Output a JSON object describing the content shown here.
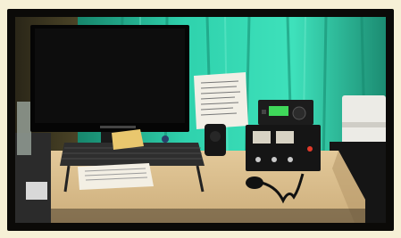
{
  "photo": {
    "scene": "ham-radio-station-desk",
    "monitor_brand": "",
    "colors": {
      "curtain": "#2fd2ad",
      "desk": "#dcc190",
      "frame": "#0b0a08",
      "background": "#f6f0d6",
      "radio_display": "#3fd85a",
      "power_led": "#e23a2a"
    }
  }
}
